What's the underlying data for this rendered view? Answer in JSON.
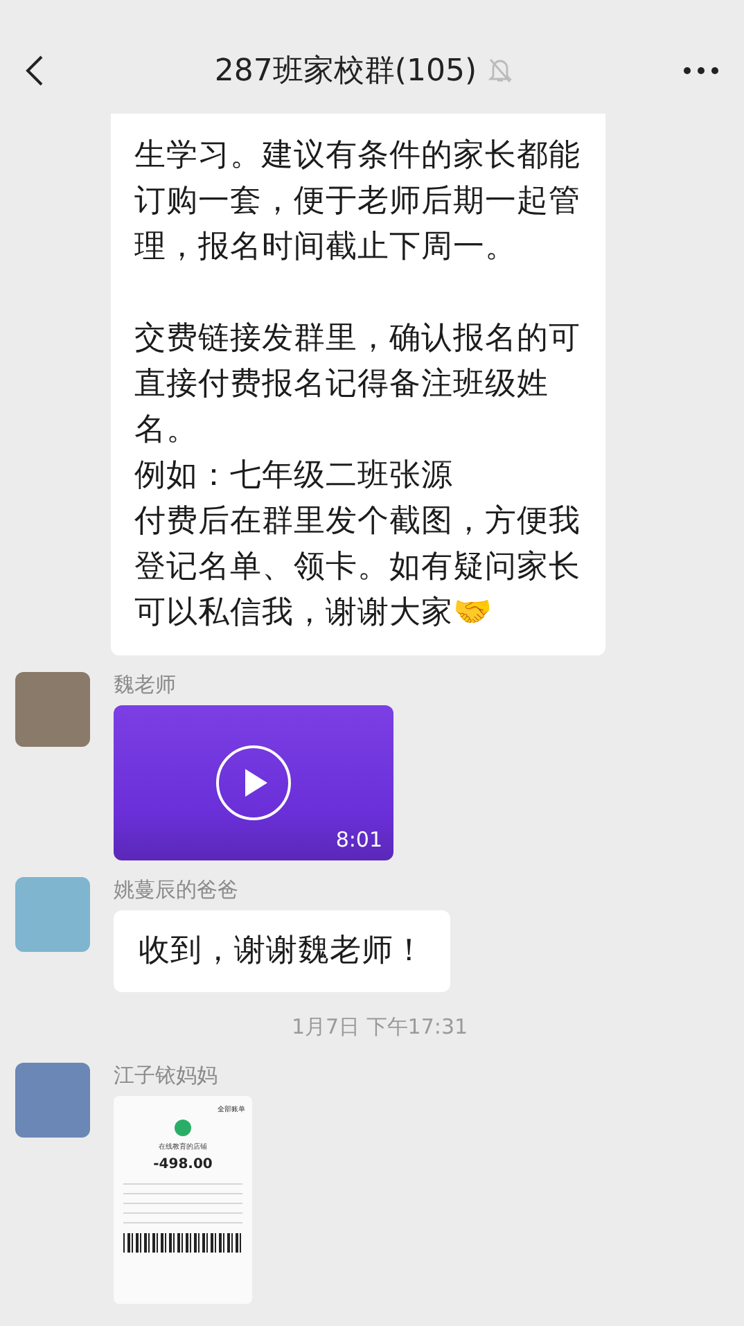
{
  "header": {
    "title": "287班家校群(105)",
    "muted": true
  },
  "messages": [
    {
      "kind": "text",
      "sections": [
        [
          "生学习。建议有条件的家长都能",
          "订购一套，便于老师后期一起管",
          "理，报名时间截止下周一。"
        ],
        [
          "交费链接发群里，确认报名的可",
          "直接付费报名记得备注班级姓",
          "名。",
          "例如：七年级二班张源",
          "付费后在群里发个截图，方便我",
          "登记名单、领卡。如有疑问家长",
          "可以私信我，谢谢大家🤝"
        ]
      ]
    },
    {
      "kind": "video",
      "sender": "魏老师",
      "duration": "8:01"
    },
    {
      "kind": "text",
      "sender": "姚蔓辰的爸爸",
      "sections": [
        [
          "收到，谢谢魏老师！"
        ]
      ]
    },
    {
      "kind": "time",
      "text": "1月7日 下午17:31"
    },
    {
      "kind": "image",
      "sender": "江子铱妈妈",
      "receipt": {
        "link": "全部账单",
        "merchant": "在线教育的店铺",
        "amount": "-498.00"
      }
    }
  ]
}
